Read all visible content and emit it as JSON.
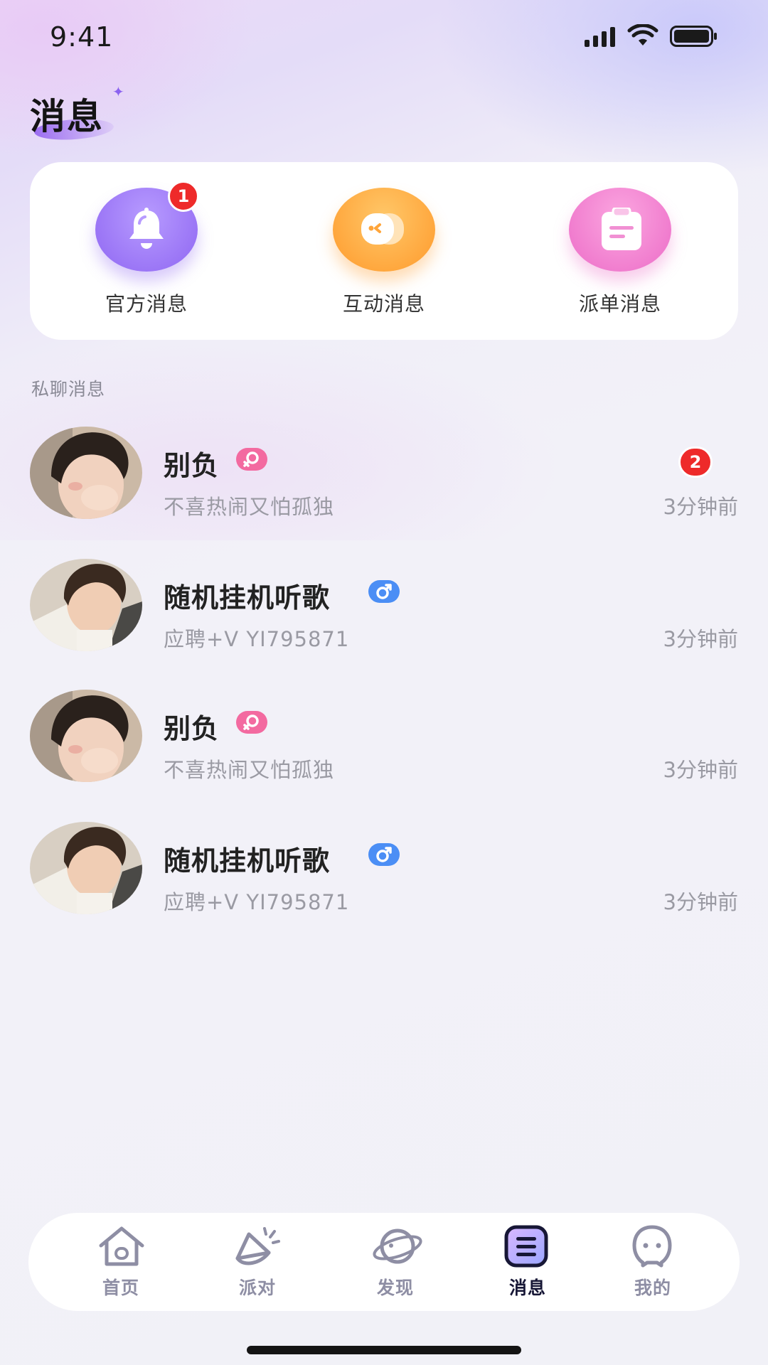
{
  "status": {
    "time": "9:41"
  },
  "header": {
    "title": "消息"
  },
  "quick": [
    {
      "label": "官方消息",
      "icon": "bell-icon",
      "color": "#8f66f2",
      "badge": "1"
    },
    {
      "label": "互动消息",
      "icon": "chat-bubbles-icon",
      "color": "#ff9a2c"
    },
    {
      "label": "派单消息",
      "icon": "clipboard-icon",
      "color": "#ec6cc7"
    }
  ],
  "section": {
    "label": "私聊消息"
  },
  "chats": [
    {
      "name": "别负",
      "gender": "female",
      "preview": "不喜热闹又怕孤独",
      "time": "3分钟前",
      "badge": "2"
    },
    {
      "name": "随机挂机听歌",
      "gender": "male",
      "preview": "应聘+V YI795871",
      "time": "3分钟前"
    },
    {
      "name": "别负",
      "gender": "female",
      "preview": "不喜热闹又怕孤独",
      "time": "3分钟前"
    },
    {
      "name": "随机挂机听歌",
      "gender": "male",
      "preview": "应聘+V YI795871",
      "time": "3分钟前"
    }
  ],
  "tabs": [
    {
      "label": "首页",
      "icon": "home-icon"
    },
    {
      "label": "派对",
      "icon": "party-icon"
    },
    {
      "label": "发现",
      "icon": "planet-icon"
    },
    {
      "label": "消息",
      "icon": "message-icon",
      "active": true
    },
    {
      "label": "我的",
      "icon": "profile-icon"
    }
  ]
}
